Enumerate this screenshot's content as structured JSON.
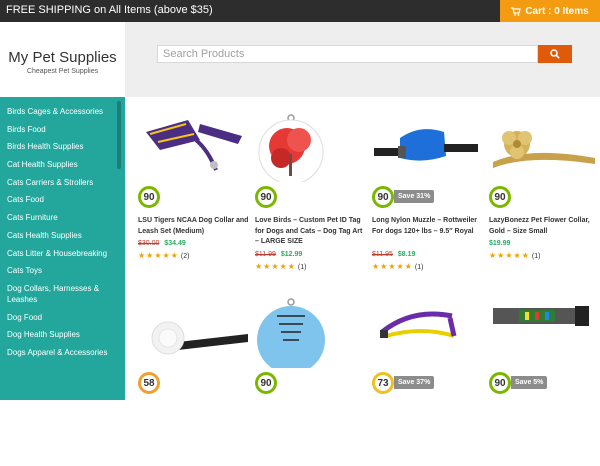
{
  "topbar": {
    "shipping": "FREE SHIPPING on All Items (above $35)",
    "cart": "Cart : 0 Items"
  },
  "logo": {
    "title": "My Pet Supplies",
    "tagline": "Cheapest Pet Supplies"
  },
  "search": {
    "placeholder": "Search Products"
  },
  "sidebar": {
    "items": [
      "Birds Cages & Accessories",
      "Birds Food",
      "Birds Health Supplies",
      "Cat Health Supplies",
      "Cats Carriers & Strollers",
      "Cats Food",
      "Cats Furniture",
      "Cats Health Supplies",
      "Cats Litter & Housebreaking",
      "Cats Toys",
      "Dog Collars, Harnesses & Leashes",
      "Dog Food",
      "Dog Health Supplies",
      "Dogs Apparel & Accessories"
    ]
  },
  "products": [
    {
      "score": "90",
      "save": "",
      "title": "LSU Tigers NCAA Dog Collar and Leash Set (Medium)",
      "old": "$30.00",
      "new": "$34.49",
      "stars": "★★★★★",
      "reviews": "(2)"
    },
    {
      "score": "90",
      "save": "",
      "title": "Love Birds – Custom Pet ID Tag for Dogs and Cats – Dog Tag Art – LARGE SIZE",
      "old": "$11.99",
      "new": "$12.99",
      "stars": "★★★★★",
      "reviews": "(1)"
    },
    {
      "score": "90",
      "save": "Save 31%",
      "title": "Long Nylon Muzzle – Rottweiler For dogs 120+ lbs – 9.5″ Royal",
      "old": "$11.95",
      "new": "$8.19",
      "stars": "★★★★★",
      "reviews": "(1)"
    },
    {
      "score": "90",
      "save": "",
      "title": "LazyBonezz Pet Flower Collar, Gold – Size Small",
      "old": "",
      "new": "$19.99",
      "stars": "★★★★★",
      "reviews": "(1)"
    },
    {
      "score": "58",
      "save": ""
    },
    {
      "score": "90",
      "save": ""
    },
    {
      "score": "73",
      "save": "Save 37%"
    },
    {
      "score": "90",
      "save": "Save 5%"
    }
  ],
  "colors": {
    "accent": "#f39c12",
    "sidebar": "#23a79c",
    "search_button": "#e05a0b",
    "badge_green": "#7ab800",
    "badge_orange": "#f0a030",
    "badge_yellow": "#f0c020"
  },
  "icons": {
    "cart": "cart-icon",
    "search": "search-icon"
  }
}
